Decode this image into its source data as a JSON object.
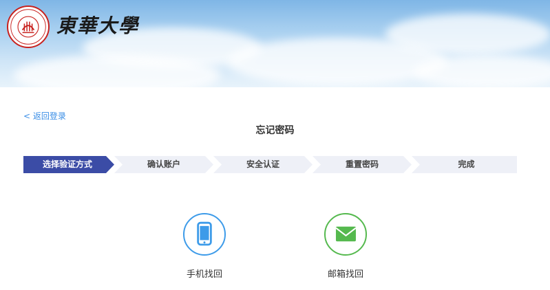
{
  "header": {
    "university_name": "東華大學"
  },
  "nav": {
    "back_label": "< 返回登录"
  },
  "page": {
    "title": "忘记密码"
  },
  "steps": [
    {
      "label": "选择验证方式",
      "active": true
    },
    {
      "label": "确认账户",
      "active": false
    },
    {
      "label": "安全认证",
      "active": false
    },
    {
      "label": "重置密码",
      "active": false
    },
    {
      "label": "完成",
      "active": false
    }
  ],
  "methods": [
    {
      "label": "手机找回",
      "icon": "phone-icon",
      "color": "#3d9be9"
    },
    {
      "label": "邮箱找回",
      "icon": "mail-icon",
      "color": "#55b94e"
    }
  ],
  "colors": {
    "accent": "#3b4ca6",
    "link": "#3a8ee6",
    "step_inactive": "#eef0f7"
  }
}
